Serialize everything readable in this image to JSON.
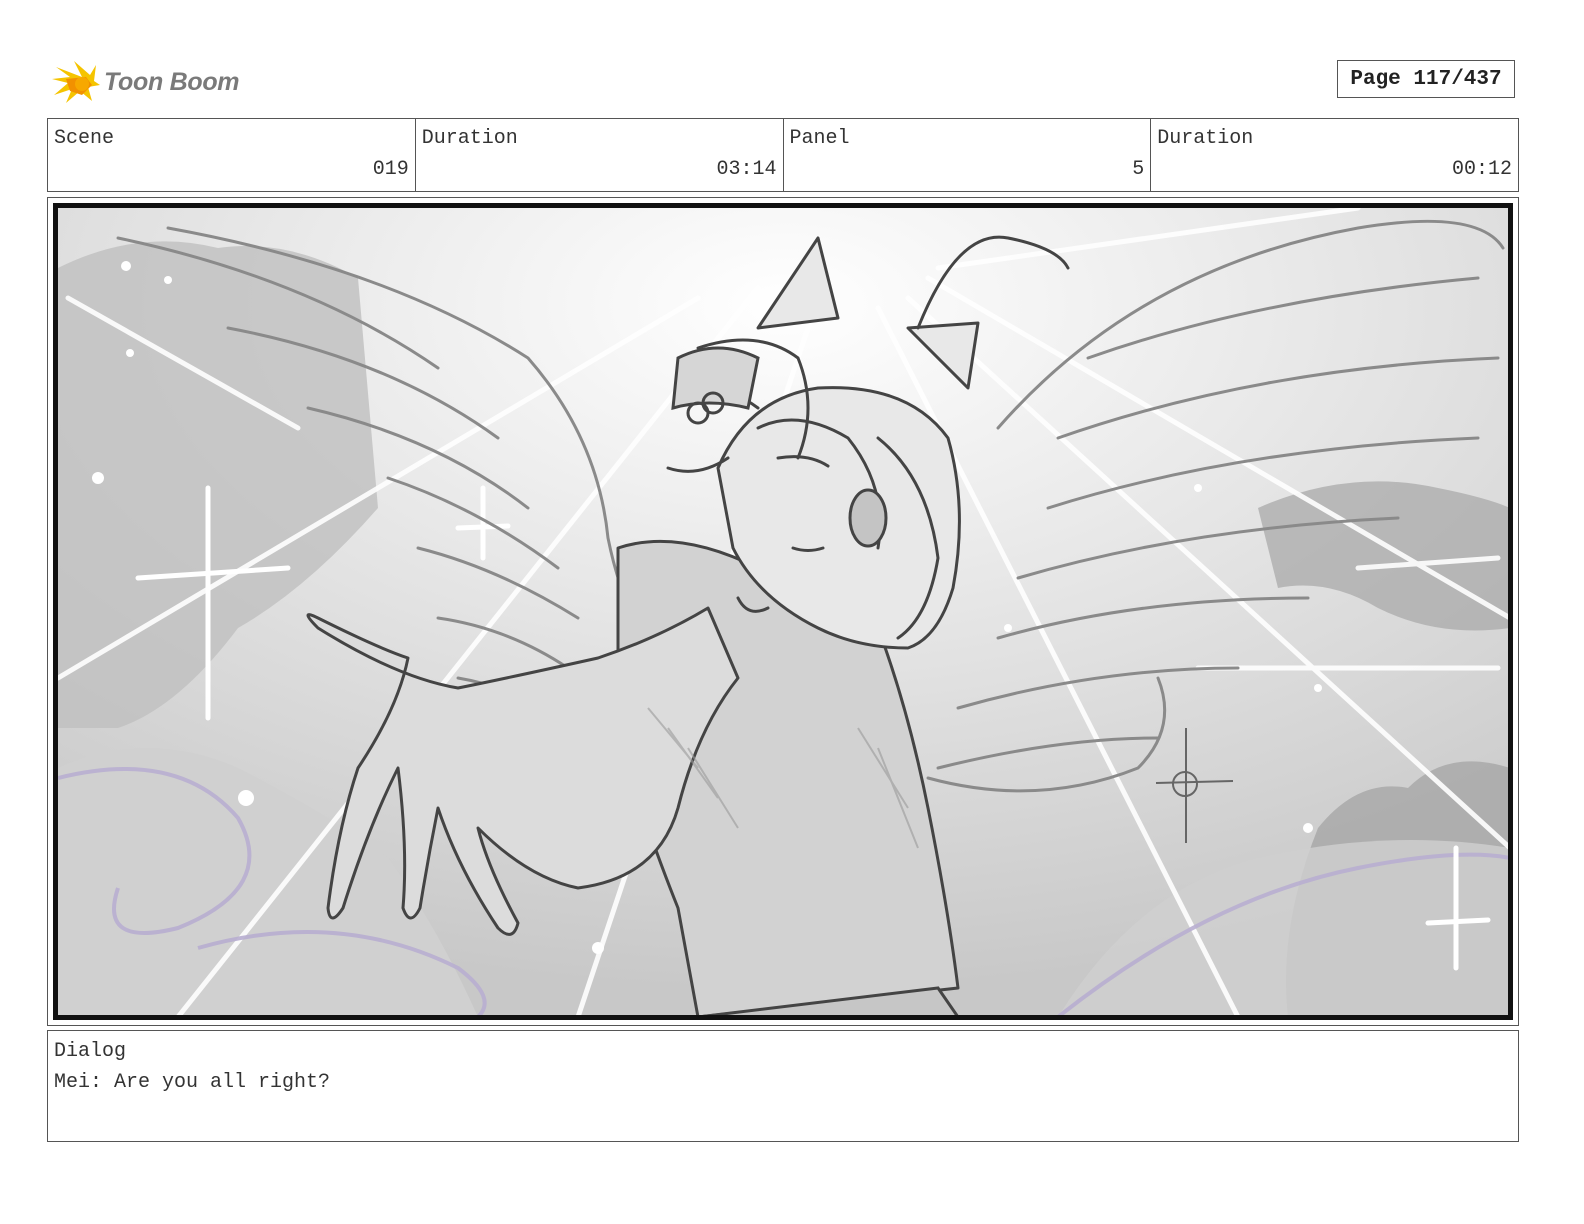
{
  "header": {
    "logo_text": "Toon Boom",
    "logo_icon": "toon-boom-burst-icon",
    "page_label": "Page 117/437"
  },
  "info": {
    "scene_label": "Scene",
    "scene_value": "019",
    "scene_duration_label": "Duration",
    "scene_duration_value": "03:14",
    "panel_label": "Panel",
    "panel_value": "5",
    "panel_duration_label": "Duration",
    "panel_duration_value": "00:12"
  },
  "panel_image": {
    "description_icon": "storyboard-sketch-winged-girl-reaching"
  },
  "dialog": {
    "label": "Dialog",
    "text": "Mei: Are you all right?"
  },
  "colors": {
    "logo_yellow": "#f5c400",
    "logo_orange": "#f29100",
    "logo_text": "#7a7a7a",
    "border": "#555555",
    "panel_border": "#111111",
    "sketch_line": "#444444",
    "sketch_purple": "#b8aed0"
  }
}
